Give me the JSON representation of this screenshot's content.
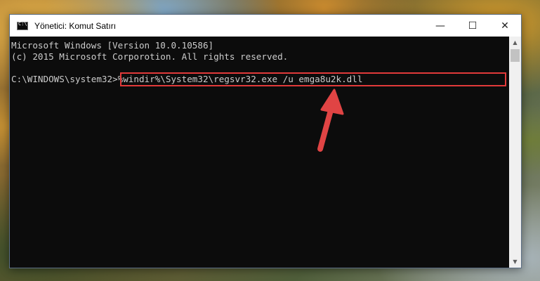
{
  "window": {
    "title": "Yönetici: Komut Satırı",
    "minimize_glyph": "—",
    "maximize_glyph": "☐",
    "close_glyph": "✕"
  },
  "console": {
    "lines": [
      "Microsoft Windows [Version 10.0.10586]",
      "(c) 2015 Microsoft Corporotion. All rights reserved.",
      "C:\\WINDOWS\\system32>%windir%\\System32\\regsvr32.exe /u emga8u2k.dll"
    ]
  },
  "scrollbar": {
    "up_glyph": "▲",
    "down_glyph": "▼"
  },
  "colors": {
    "highlight": "#e13a3a",
    "console_bg": "#0c0c0c",
    "console_text": "#cccccc"
  },
  "icons": [
    "cmd-app-icon",
    "minimize-icon",
    "maximize-icon",
    "close-icon",
    "pointer-arrow-icon"
  ]
}
